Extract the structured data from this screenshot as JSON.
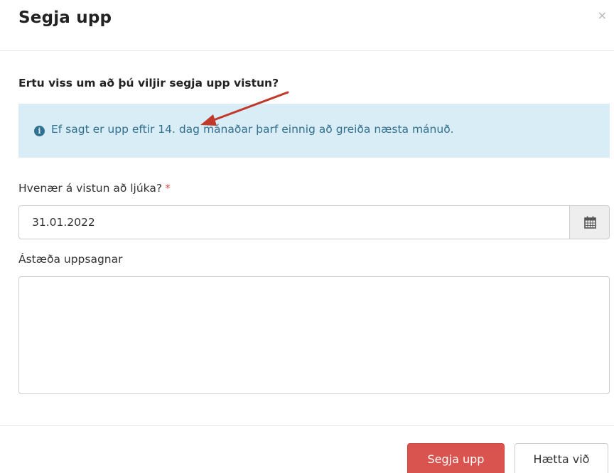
{
  "modal": {
    "title": "Segja upp",
    "close_symbol": "×"
  },
  "question": "Ertu viss um að þú viljir segja upp vistun?",
  "info_box": {
    "icon": "info-circle-icon",
    "text": "Ef sagt er upp eftir 14. dag mánaðar þarf einnig að greiða næsta mánuð.",
    "background": "#d9edf7",
    "text_color": "#31708f"
  },
  "annotation": {
    "type": "arrow",
    "color": "#c0392b"
  },
  "end_date_field": {
    "label": "Hvenær á vistun að ljúka?",
    "required_marker": "*",
    "value": "31.01.2022",
    "addon_icon": "calendar-icon"
  },
  "reason_field": {
    "label": "Ástæða uppsagnar",
    "value": ""
  },
  "footer": {
    "confirm_label": "Segja upp",
    "cancel_label": "Hætta við"
  },
  "colors": {
    "danger": "#d9534f",
    "required": "#d9534f"
  }
}
